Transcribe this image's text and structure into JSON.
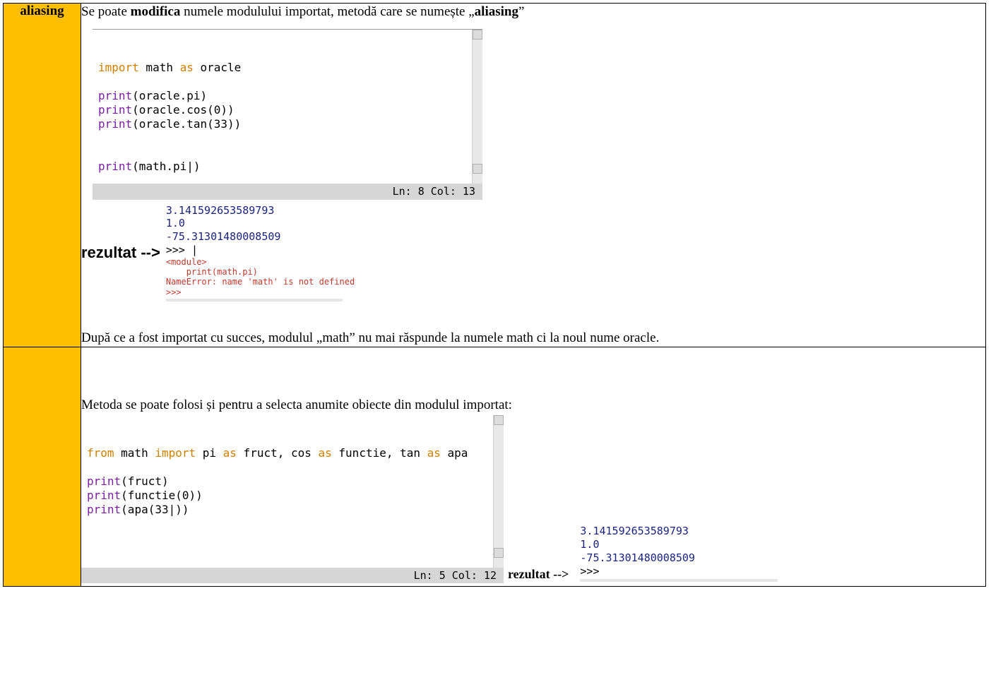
{
  "row1": {
    "label": "aliasing",
    "intro_pre": "Se poate ",
    "intro_bold": "modifica",
    "intro_mid": " numele modulului importat, metodă care se numește „",
    "intro_bold2": "aliasing",
    "intro_post": "”",
    "editor": {
      "lines": [
        {
          "tokens": [
            {
              "cls": "kw1",
              "text": "import"
            },
            {
              "cls": "txt",
              "text": " math "
            },
            {
              "cls": "kw2",
              "text": "as"
            },
            {
              "cls": "txt",
              "text": " oracle"
            }
          ]
        },
        {
          "tokens": []
        },
        {
          "tokens": [
            {
              "cls": "fn",
              "text": "print"
            },
            {
              "cls": "txt",
              "text": "(oracle.pi)"
            }
          ]
        },
        {
          "tokens": [
            {
              "cls": "fn",
              "text": "print"
            },
            {
              "cls": "txt",
              "text": "(oracle.cos(0))"
            }
          ]
        },
        {
          "tokens": [
            {
              "cls": "fn",
              "text": "print"
            },
            {
              "cls": "txt",
              "text": "(oracle.tan(33))"
            }
          ]
        },
        {
          "tokens": []
        },
        {
          "tokens": []
        },
        {
          "tokens": [
            {
              "cls": "fn",
              "text": "print"
            },
            {
              "cls": "txt",
              "text": "(math.pi|)"
            }
          ]
        }
      ],
      "status": "Ln: 8  Col: 13"
    },
    "result_label": "rezultat -->",
    "output_blue": "3.141592653589793\n1.0\n-75.31301480008509",
    "output_prompt": ">>> |",
    "output_red": "<module>\n    print(math.pi)\nNameError: name 'math' is not defined",
    "output_prompt2": ">>>",
    "outro": "După ce a fost importat cu succes, modulul „math” nu mai răspunde la numele math ci la noul nume oracle."
  },
  "row2": {
    "label": "",
    "intro": "Metoda se poate folosi și pentru a selecta anumite obiecte din modulul importat:",
    "editor": {
      "lines": [
        {
          "tokens": [
            {
              "cls": "kw1",
              "text": "from"
            },
            {
              "cls": "txt",
              "text": " math "
            },
            {
              "cls": "kw1",
              "text": "import"
            },
            {
              "cls": "txt",
              "text": " pi "
            },
            {
              "cls": "kw2",
              "text": "as"
            },
            {
              "cls": "txt",
              "text": " fruct, cos "
            },
            {
              "cls": "kw2",
              "text": "as"
            },
            {
              "cls": "txt",
              "text": " functie, tan "
            },
            {
              "cls": "kw2",
              "text": "as"
            },
            {
              "cls": "txt",
              "text": " apa"
            }
          ]
        },
        {
          "tokens": []
        },
        {
          "tokens": [
            {
              "cls": "fn",
              "text": "print"
            },
            {
              "cls": "txt",
              "text": "(fruct)"
            }
          ]
        },
        {
          "tokens": [
            {
              "cls": "fn",
              "text": "print"
            },
            {
              "cls": "txt",
              "text": "(functie(0))"
            }
          ]
        },
        {
          "tokens": [
            {
              "cls": "fn",
              "text": "print"
            },
            {
              "cls": "txt",
              "text": "(apa(33|))"
            }
          ]
        }
      ],
      "status": "Ln: 5  Col: 12"
    },
    "result_label": "rezultat -->",
    "output_blue": "3.141592653589793\n1.0\n-75.31301480008509",
    "output_prompt": ">>>"
  }
}
